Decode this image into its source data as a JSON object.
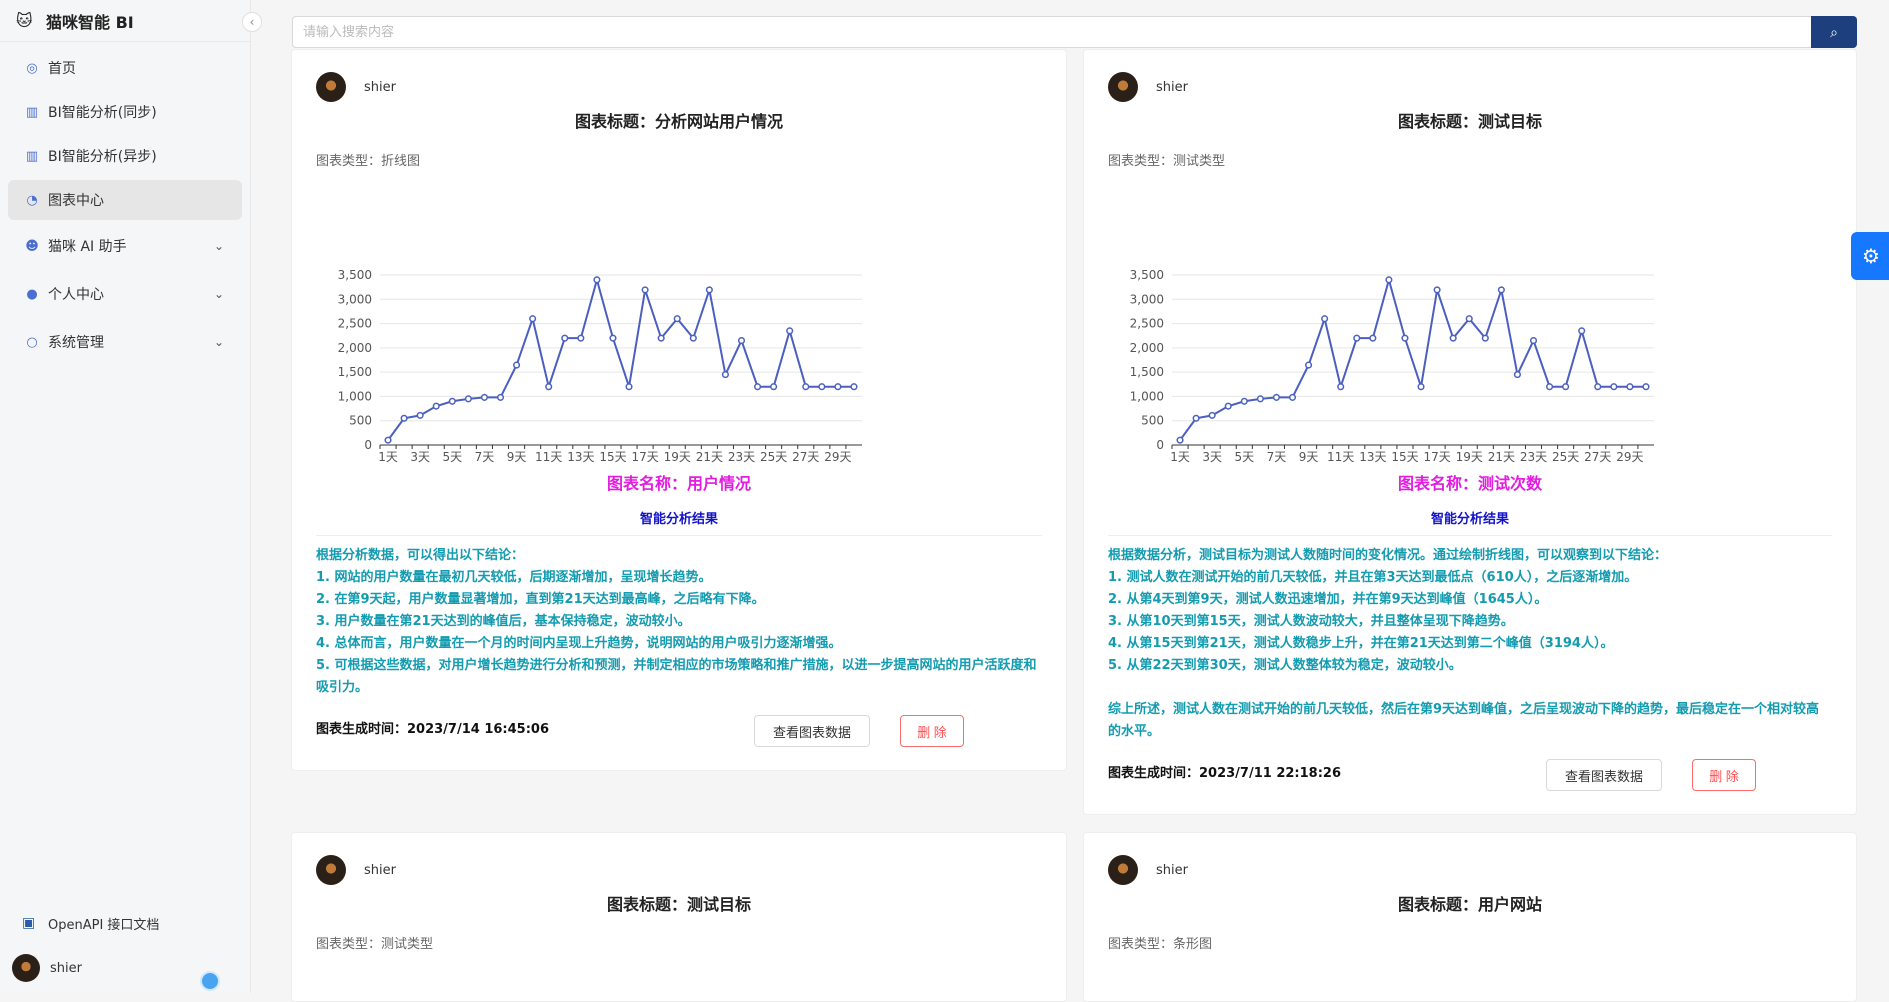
{
  "app": {
    "title": "猫咪智能 BI",
    "logo_icon": "cat-icon"
  },
  "sidebar": {
    "items": [
      {
        "label": "首页",
        "icon": "dashboard-icon"
      },
      {
        "label": "BI智能分析(同步)",
        "icon": "bar-chart-icon"
      },
      {
        "label": "BI智能分析(异步)",
        "icon": "bar-chart-icon"
      },
      {
        "label": "图表中心",
        "icon": "pie-chart-icon"
      },
      {
        "label": "猫咪 AI 助手",
        "icon": "robot-icon"
      },
      {
        "label": "个人中心",
        "icon": "user-icon"
      },
      {
        "label": "系统管理",
        "icon": "user-admin-icon"
      }
    ],
    "openapi": "OpenAPI 接口文档",
    "user": "shier"
  },
  "search": {
    "placeholder": "请输入搜索内容"
  },
  "cards": [
    {
      "author": "shier",
      "title": "图表标题：分析网站用户情况",
      "type": "图表类型：折线图",
      "name": "图表名称：用户情况",
      "analysis_header": "智能分析结果",
      "analysis": [
        "根据分析数据，可以得出以下结论：",
        "1. 网站的用户数量在最初几天较低，后期逐渐增加，呈现增长趋势。",
        "2. 在第9天起，用户数量显著增加，直到第21天达到最高峰，之后略有下降。",
        "3. 用户数量在第21天达到的峰值后，基本保持稳定，波动较小。",
        "4. 总体而言，用户数量在一个月的时间内呈现上升趋势，说明网站的用户吸引力逐渐增强。",
        "5. 可根据这些数据，对用户增长趋势进行分析和预测，并制定相应的市场策略和推广措施，以进一步提高网站的用户活跃度和吸引力。"
      ],
      "time": "图表生成时间：2023/7/14 16:45:06",
      "view_label": "查看图表数据",
      "delete_label": "删 除"
    },
    {
      "author": "shier",
      "title": "图表标题：测试目标",
      "type": "图表类型：测试类型",
      "name": "图表名称：测试次数",
      "analysis_header": "智能分析结果",
      "analysis": [
        "根据数据分析，测试目标为测试人数随时间的变化情况。通过绘制折线图，可以观察到以下结论：",
        "1. 测试人数在测试开始的前几天较低，并且在第3天达到最低点（610人），之后逐渐增加。",
        "2. 从第4天到第9天，测试人数迅速增加，并在第9天达到峰值（1645人）。",
        "3. 从第10天到第15天，测试人数波动较大，并且整体呈现下降趋势。",
        "4. 从第15天到第21天，测试人数稳步上升，并在第21天达到第二个峰值（3194人）。",
        "5. 从第22天到第30天，测试人数整体较为稳定，波动较小。",
        "",
        "综上所述，测试人数在测试开始的前几天较低，然后在第9天达到峰值，之后呈现波动下降的趋势，最后稳定在一个相对较高的水平。"
      ],
      "time": "图表生成时间：2023/7/11 22:18:26",
      "view_label": "查看图表数据",
      "delete_label": "删 除"
    },
    {
      "author": "shier",
      "title": "图表标题：测试目标",
      "type": "图表类型：测试类型"
    },
    {
      "author": "shier",
      "title": "图表标题：用户网站",
      "type": "图表类型：条形图"
    }
  ],
  "chart_data": [
    {
      "type": "line",
      "x": [
        "1天",
        "2天",
        "3天",
        "4天",
        "5天",
        "6天",
        "7天",
        "8天",
        "9天",
        "10天",
        "11天",
        "12天",
        "13天",
        "14天",
        "15天",
        "16天",
        "17天",
        "18天",
        "19天",
        "20天",
        "21天",
        "22天",
        "23天",
        "24天",
        "25天",
        "26天",
        "27天",
        "28天",
        "29天",
        "30天"
      ],
      "x_tick_labels": [
        "1天",
        "3天",
        "5天",
        "7天",
        "9天",
        "11天",
        "13天",
        "15天",
        "17天",
        "19天",
        "21天",
        "23天",
        "25天",
        "27天",
        "29天"
      ],
      "values": [
        100,
        550,
        610,
        800,
        900,
        950,
        980,
        980,
        1645,
        2600,
        1200,
        2200,
        2200,
        3400,
        2200,
        1200,
        3194,
        2200,
        2600,
        2200,
        3194,
        1450,
        2150,
        1200,
        1200,
        2350,
        1200,
        1200,
        1200,
        1200
      ],
      "ylim": [
        0,
        3500
      ],
      "y_ticks": [
        "0",
        "500",
        "1,000",
        "1,500",
        "2,000",
        "2,500",
        "3,000",
        "3,500"
      ],
      "color": "#4a5fc1",
      "grid": true
    },
    {
      "type": "line",
      "x": [
        "1天",
        "2天",
        "3天",
        "4天",
        "5天",
        "6天",
        "7天",
        "8天",
        "9天",
        "10天",
        "11天",
        "12天",
        "13天",
        "14天",
        "15天",
        "16天",
        "17天",
        "18天",
        "19天",
        "20天",
        "21天",
        "22天",
        "23天",
        "24天",
        "25天",
        "26天",
        "27天",
        "28天",
        "29天",
        "30天"
      ],
      "x_tick_labels": [
        "1天",
        "3天",
        "5天",
        "7天",
        "9天",
        "11天",
        "13天",
        "15天",
        "17天",
        "19天",
        "21天",
        "23天",
        "25天",
        "27天",
        "29天"
      ],
      "values": [
        100,
        550,
        610,
        800,
        900,
        950,
        980,
        980,
        1645,
        2600,
        1200,
        2200,
        2200,
        3400,
        2200,
        1200,
        3194,
        2200,
        2600,
        2200,
        3194,
        1450,
        2150,
        1200,
        1200,
        2350,
        1200,
        1200,
        1200,
        1200
      ],
      "ylim": [
        0,
        3500
      ],
      "y_ticks": [
        "0",
        "500",
        "1,000",
        "1,500",
        "2,000",
        "2,500",
        "3,000",
        "3,500"
      ],
      "color": "#4a5fc1",
      "grid": true
    }
  ],
  "colors": {
    "accent": "#1d3f7e",
    "chart_name": "#e21de0",
    "analysis": "#139bb0",
    "analysis_header": "#1414c8",
    "fab": "#1677ff"
  }
}
